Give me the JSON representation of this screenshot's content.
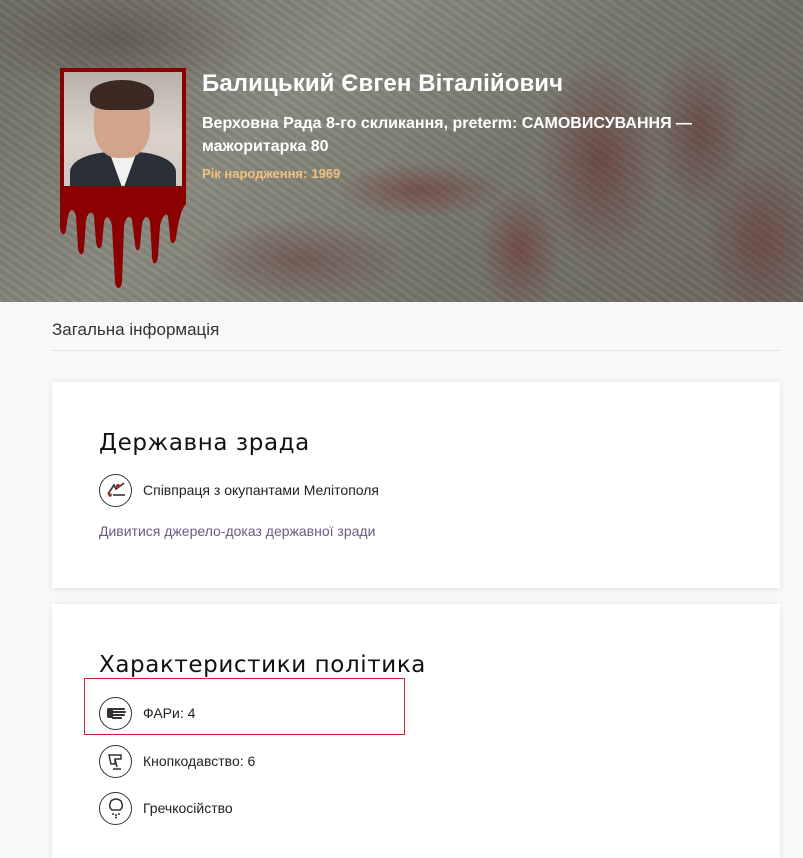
{
  "politician": {
    "name": "Балицький Євген Віталійович",
    "subtitle": "Верховна Рада 8-го скликання, preterm: САМОВИСУВАННЯ — мажоритарка 80",
    "birth_label": "Рік народження:",
    "birth_year": "1969"
  },
  "general_section": {
    "title": "Загальна інформація"
  },
  "treason_card": {
    "heading": "Державна зрада",
    "item_icon": "treason-icon",
    "item_label": "Співпраця з окупантами Мелітополя",
    "link_text": "Дивитися джерело-доказ державної зради"
  },
  "traits_card": {
    "heading": "Характеристики політика",
    "items": [
      {
        "icon": "hand-fari-icon",
        "label": "ФАРи: 4"
      },
      {
        "icon": "button-press-icon",
        "label": "Кнопкодавство: 6"
      },
      {
        "icon": "buckwheat-icon",
        "label": "Гречкосійство"
      }
    ]
  },
  "colors": {
    "accent_link": "#6b5a80",
    "birth_text": "#f1c27d",
    "photo_frame": "#8b0000",
    "highlight": "#c0282d"
  }
}
